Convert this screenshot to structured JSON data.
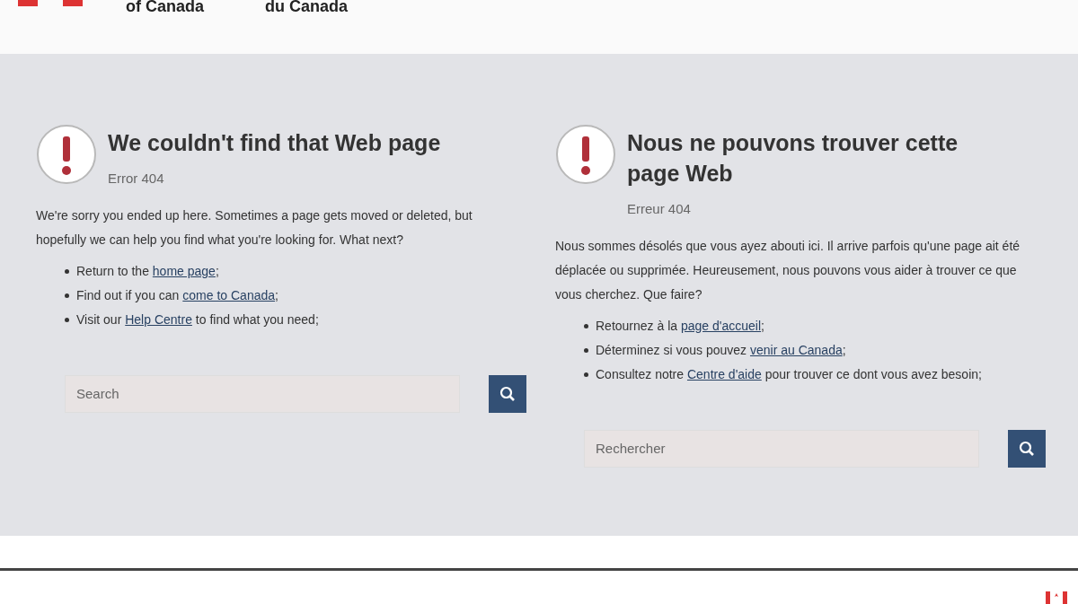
{
  "header": {
    "org_en": "of Canada",
    "org_fr": "du Canada"
  },
  "columns": [
    {
      "title": "We couldn't find that Web page",
      "code": "Error 404",
      "intro": "We're sorry you ended up here. Sometimes a page gets moved or deleted, but hopefully we can help you find what you're looking for. What next?",
      "items": [
        {
          "before": "Return to the ",
          "link": "home page",
          "after": ";"
        },
        {
          "before": "Find out if you can ",
          "link": "come to Canada",
          "after": ";"
        },
        {
          "before": "Visit our ",
          "link": "Help Centre",
          "after": " to find what you need;"
        }
      ],
      "search": {
        "placeholder": "Search"
      }
    },
    {
      "title": "Nous ne pouvons trouver cette page Web",
      "code": "Erreur 404",
      "intro": "Nous sommes désolés que vous ayez abouti ici. Il arrive parfois qu'une page ait été déplacée ou supprimée. Heureusement, nous pouvons vous aider à trouver ce que vous cherchez. Que faire?",
      "items": [
        {
          "before": "Retournez à la ",
          "link": "page d'accueil",
          "after": ";"
        },
        {
          "before": "Déterminez si vous pouvez ",
          "link": "venir au Canada",
          "after": ";"
        },
        {
          "before": "Consultez notre ",
          "link": "Centre d'aide",
          "after": " pour trouver ce dont vous avez besoin;"
        }
      ],
      "search": {
        "placeholder": "Rechercher"
      }
    }
  ]
}
